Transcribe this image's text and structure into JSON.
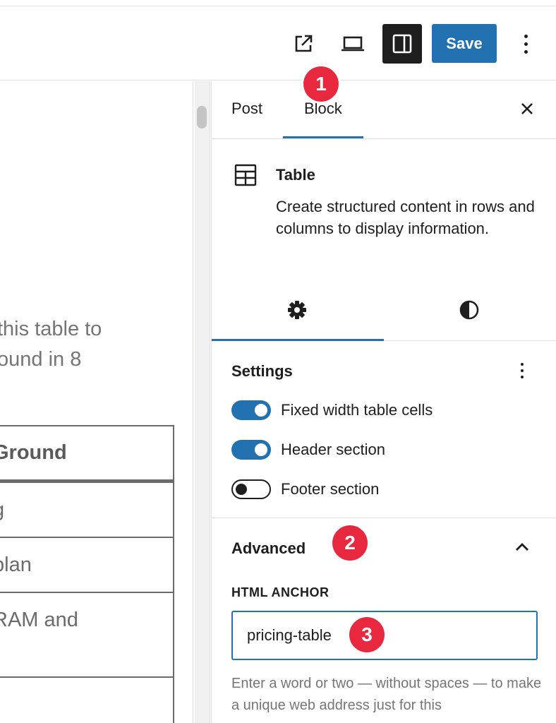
{
  "toolbar": {
    "save_label": "Save",
    "icons": [
      "external-link-icon",
      "desktop-preview-icon",
      "sidebar-toggle-icon",
      "more-options-icon"
    ]
  },
  "canvas": {
    "paragraph_lines": [
      "this table to",
      "ound in 8"
    ],
    "table_rows": [
      "Ground",
      "g",
      "plan",
      "RAM and",
      ""
    ]
  },
  "sidebar": {
    "tabs": [
      {
        "label": "Post",
        "active": false
      },
      {
        "label": "Block",
        "active": true
      }
    ],
    "block": {
      "title": "Table",
      "description": "Create structured content in rows and columns to display information."
    },
    "settings": {
      "title": "Settings",
      "toggles": [
        {
          "label": "Fixed width table cells",
          "on": true
        },
        {
          "label": "Header section",
          "on": true
        },
        {
          "label": "Footer section",
          "on": false
        }
      ]
    },
    "advanced": {
      "title": "Advanced",
      "anchor_label": "HTML ANCHOR",
      "anchor_value": "pricing-table",
      "help_text": "Enter a word or two — without spaces — to make a unique web address just for this"
    }
  },
  "annotations": {
    "badge_1": "1",
    "badge_2": "2",
    "badge_3": "3"
  },
  "colors": {
    "accent": "#2271b1",
    "badge": "#e8283e",
    "dark": "#1e1e1e"
  }
}
